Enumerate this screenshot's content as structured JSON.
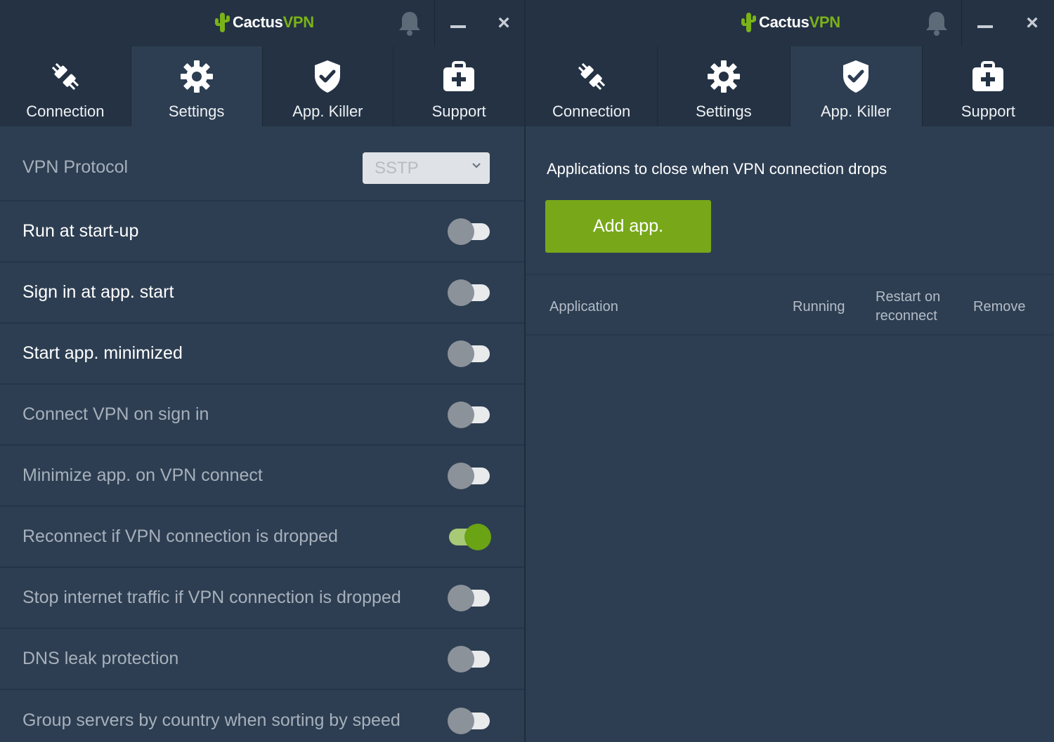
{
  "colors": {
    "brand_green": "#7ab317",
    "accent_button": "#78a81a",
    "toggle_on": "#6aa314",
    "background": "#2d3e52",
    "titlebar": "#243244"
  },
  "left_window": {
    "logo_part1": "Cactus",
    "logo_part2": "VPN",
    "tabs": [
      {
        "label": "Connection",
        "icon": "plug-icon",
        "active": false
      },
      {
        "label": "Settings",
        "icon": "gear-icon",
        "active": true
      },
      {
        "label": "App. Killer",
        "icon": "shield-check-icon",
        "active": false
      },
      {
        "label": "Support",
        "icon": "medical-kit-icon",
        "active": false
      }
    ],
    "settings": {
      "protocol_label": "VPN Protocol",
      "protocol_value": "SSTP",
      "rows": [
        {
          "label": "Run at start-up",
          "on": false,
          "enabled": true
        },
        {
          "label": "Sign in at app. start",
          "on": false,
          "enabled": true
        },
        {
          "label": "Start app. minimized",
          "on": false,
          "enabled": true
        },
        {
          "label": "Connect VPN on sign in",
          "on": false,
          "enabled": false
        },
        {
          "label": "Minimize app. on VPN connect",
          "on": false,
          "enabled": false
        },
        {
          "label": "Reconnect if VPN connection is dropped",
          "on": true,
          "enabled": false
        },
        {
          "label": "Stop internet traffic if VPN connection is dropped",
          "on": false,
          "enabled": false
        },
        {
          "label": "DNS leak protection",
          "on": false,
          "enabled": false
        },
        {
          "label": "Group servers by country when sorting by speed",
          "on": false,
          "enabled": false
        }
      ]
    }
  },
  "right_window": {
    "logo_part1": "Cactus",
    "logo_part2": "VPN",
    "tabs": [
      {
        "label": "Connection",
        "icon": "plug-icon",
        "active": false
      },
      {
        "label": "Settings",
        "icon": "gear-icon",
        "active": false
      },
      {
        "label": "App. Killer",
        "icon": "shield-check-icon",
        "active": true
      },
      {
        "label": "Support",
        "icon": "medical-kit-icon",
        "active": false
      }
    ],
    "app_killer": {
      "heading": "Applications to close when VPN connection drops",
      "add_button": "Add app.",
      "columns": {
        "application": "Application",
        "running": "Running",
        "restart_line1": "Restart on",
        "restart_line2": "reconnect",
        "remove": "Remove"
      }
    }
  }
}
